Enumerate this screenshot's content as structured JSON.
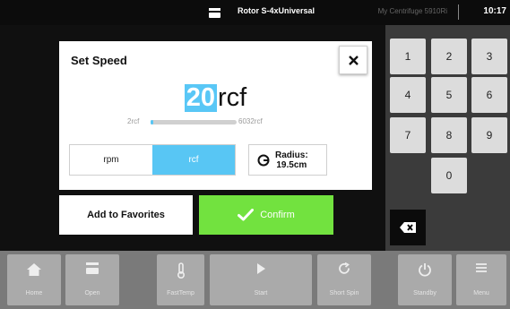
{
  "status_bar": {
    "rotor": "Rotor S-4xUniversal",
    "device": "My Centrifuge 5910Ri",
    "time": "10:17"
  },
  "dialog": {
    "title": "Set Speed",
    "value": "20",
    "unit": "rcf",
    "range_min": "2rcf",
    "range_max": "6032rcf",
    "range_fill_fraction": 0.003,
    "unit_options": {
      "rpm": "rpm",
      "rcf": "rcf"
    },
    "selected_unit": "rcf",
    "radius_label": "Radius:",
    "radius_value": "19.5cm"
  },
  "buttons": {
    "favorites": "Add to Favorites",
    "confirm": "Confirm"
  },
  "keypad": {
    "keys": [
      "1",
      "2",
      "3",
      "4",
      "5",
      "6",
      "7",
      "8",
      "9",
      "0"
    ]
  },
  "bottom_nav": [
    "Home",
    "Open",
    "FastTemp",
    "Start",
    "Short Spin",
    "Standby",
    "Menu"
  ],
  "colors": {
    "accent_blue": "#58c6f4",
    "confirm_green": "#72e23f",
    "nav_gray": "#aaaaaa"
  },
  "icons": [
    "rotor-icon",
    "close-icon",
    "radius-icon",
    "checkmark-icon",
    "backspace-icon",
    "home-icon",
    "open-icon",
    "thermometer-icon",
    "play-icon",
    "refresh-icon",
    "power-icon",
    "menu-icon"
  ]
}
